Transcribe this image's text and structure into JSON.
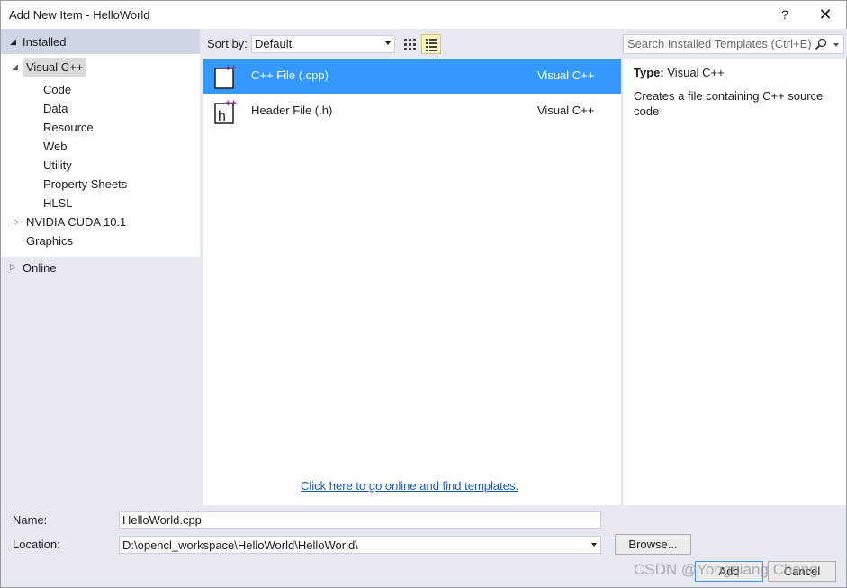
{
  "window": {
    "title": "Add New Item - HelloWorld",
    "help_label": "?",
    "close_label": "✕"
  },
  "sidebar": {
    "installed_label": "Installed",
    "tree": [
      {
        "label": "Visual C++",
        "level": 0,
        "expanded": true,
        "selected": true
      },
      {
        "label": "Code",
        "level": 1
      },
      {
        "label": "Data",
        "level": 1
      },
      {
        "label": "Resource",
        "level": 1
      },
      {
        "label": "Web",
        "level": 1
      },
      {
        "label": "Utility",
        "level": 1
      },
      {
        "label": "Property Sheets",
        "level": 1
      },
      {
        "label": "HLSL",
        "level": 1
      },
      {
        "label": "NVIDIA CUDA 10.1",
        "level": 0,
        "expanded": false
      },
      {
        "label": "Graphics",
        "level": 0
      }
    ],
    "online_label": "Online"
  },
  "toolbar": {
    "sort_label": "Sort by:",
    "sort_value": "Default"
  },
  "templates": [
    {
      "name": "C++ File (.cpp)",
      "language": "Visual C++",
      "selected": true,
      "icon": "cpp-file-icon"
    },
    {
      "name": "Header File (.h)",
      "language": "Visual C++",
      "selected": false,
      "icon": "header-file-icon"
    }
  ],
  "online_link": "Click here to go online and find templates.",
  "search": {
    "placeholder": "Search Installed Templates (Ctrl+E)"
  },
  "details": {
    "type_label": "Type:",
    "type_value": "Visual C++",
    "description": "Creates a file containing C++ source code"
  },
  "form": {
    "name_label": "Name:",
    "name_value": "HelloWorld.cpp",
    "location_label": "Location:",
    "location_value": "D:\\opencl_workspace\\HelloWorld\\HelloWorld\\",
    "browse_label": "Browse...",
    "add_label": "Add",
    "cancel_label": "Cancel"
  },
  "watermark": "CSDN @Yongqiang Cheng",
  "colors": {
    "selection": "#3399ff",
    "panel": "#e6e9f2",
    "header": "#cfd6e5",
    "link": "#1a5ab6",
    "icon_accent": "#a0208f"
  }
}
